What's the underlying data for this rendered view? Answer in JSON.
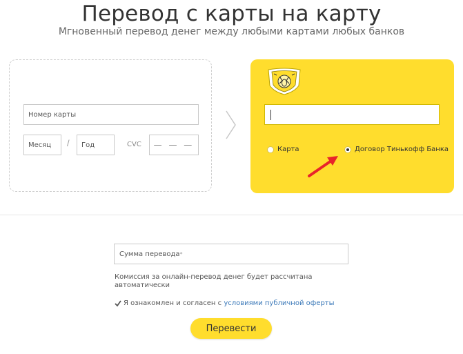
{
  "header": {
    "title": "Перевод с карты на карту",
    "subtitle": "Мгновенный перевод денег между любыми картами любых банков"
  },
  "source_card": {
    "card_number_placeholder": "Номер карты",
    "month_placeholder": "Месяц",
    "year_placeholder": "Год",
    "separator": "/",
    "cvc_label": "CVC",
    "cvc_placeholder": "— — —"
  },
  "destination_card": {
    "number_value": "",
    "options": [
      {
        "label": "Карта",
        "selected": false
      },
      {
        "label": "Договор Тинькофф Банка",
        "selected": true
      }
    ]
  },
  "transfer": {
    "amount_placeholder": "Сумма перевода",
    "amount_required_mark": "*",
    "commission_text": "Комиссия за онлайн-перевод денег будет рассчитана автоматически",
    "agree_prefix": "Я ознакомлен и согласен с ",
    "agree_link": "условиями публичной оферты",
    "agree_checked": true,
    "submit_label": "Перевести"
  },
  "colors": {
    "accent_yellow": "#ffdd2d",
    "arrow_red": "#e8242a",
    "link_blue": "#3a78b8"
  },
  "icons": [
    "tinkoff-logo-icon",
    "chevron-right-icon",
    "red-arrow-icon",
    "checkmark-icon"
  ]
}
